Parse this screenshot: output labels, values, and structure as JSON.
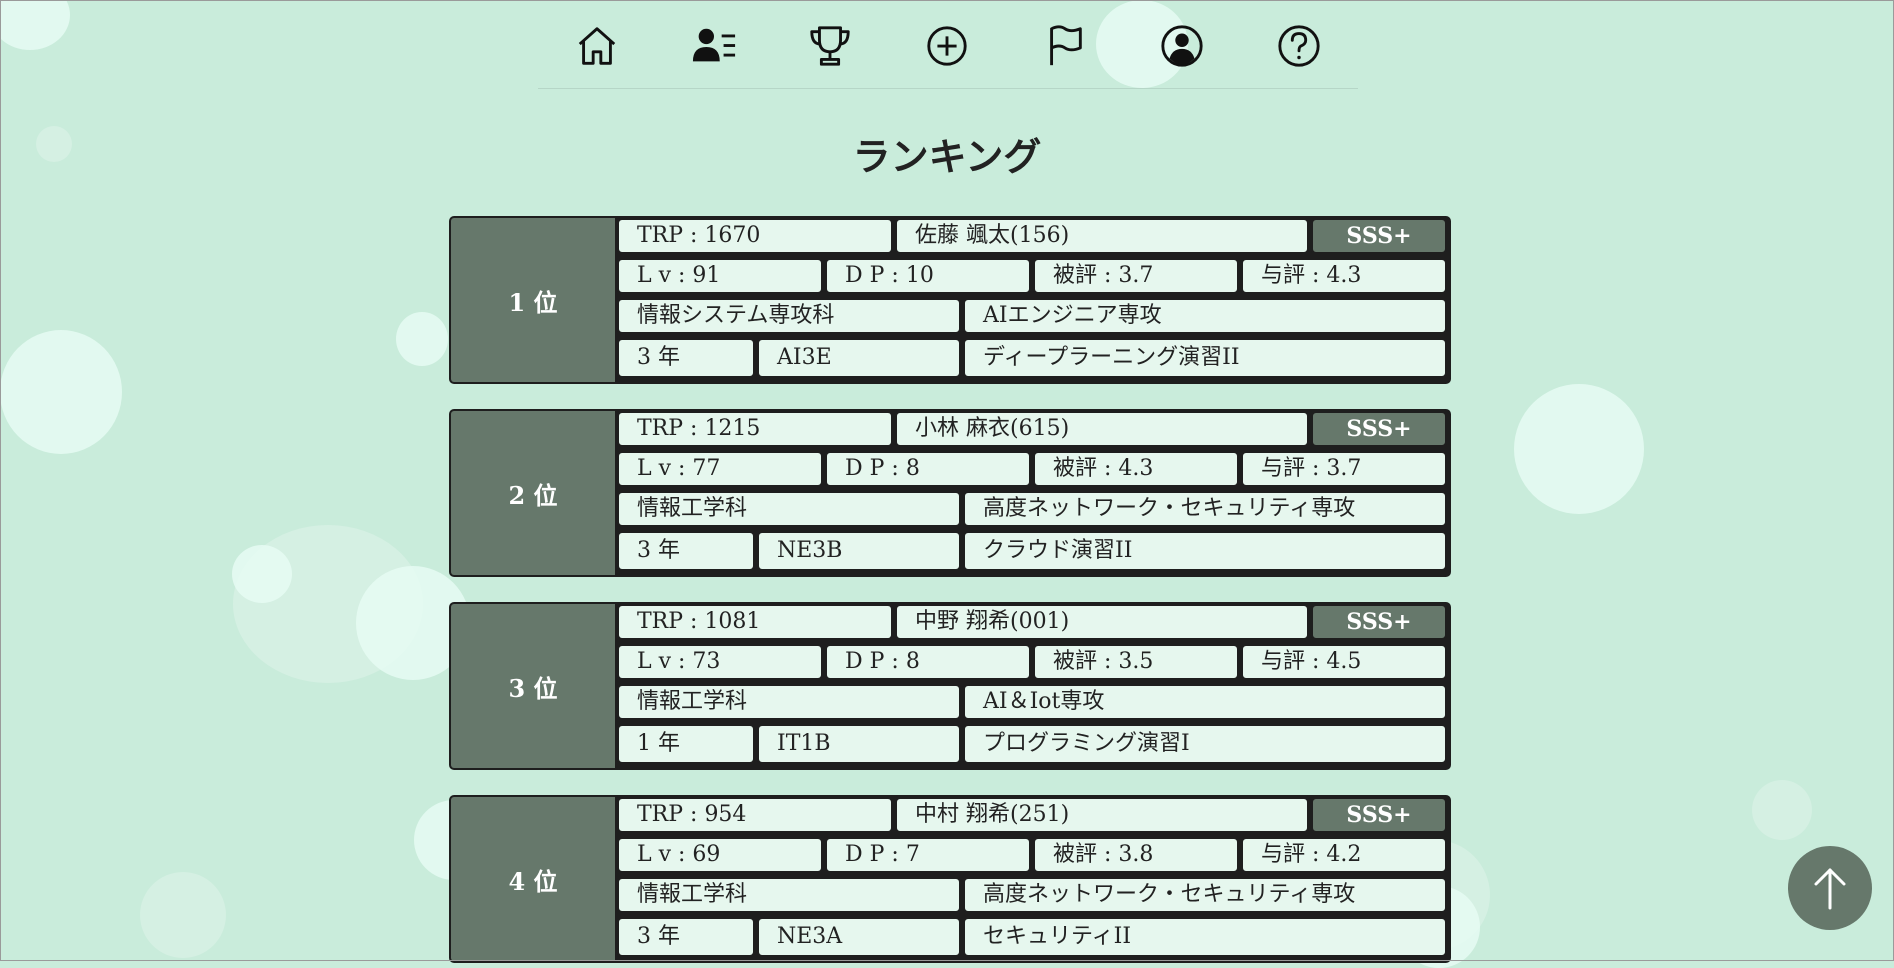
{
  "nav": {
    "items": [
      {
        "icon": "home-icon"
      },
      {
        "icon": "user-list-icon"
      },
      {
        "icon": "trophy-icon"
      },
      {
        "icon": "plus-circle-icon"
      },
      {
        "icon": "flag-icon"
      },
      {
        "icon": "account-circle-icon"
      },
      {
        "icon": "help-circle-icon"
      }
    ]
  },
  "page": {
    "title": "ランキング"
  },
  "rankings": [
    {
      "rank": "1 位",
      "trp": "TRP : 1670",
      "name": "佐藤 颯太(156)",
      "badge": "SSS+",
      "lv": "L v : 91",
      "dp": "D P : 10",
      "hi": "被評 : 3.7",
      "yo": "与評 : 4.3",
      "dept": "情報システム専攻科",
      "major": "AIエンジニア専攻",
      "year": "3 年",
      "class": "AI3E",
      "subject": "ディープラーニング演習II"
    },
    {
      "rank": "2 位",
      "trp": "TRP : 1215",
      "name": "小林 麻衣(615)",
      "badge": "SSS+",
      "lv": "L v : 77",
      "dp": "D P : 8",
      "hi": "被評 : 4.3",
      "yo": "与評 : 3.7",
      "dept": "情報工学科",
      "major": "高度ネットワーク・セキュリティ専攻",
      "year": "3 年",
      "class": "NE3B",
      "subject": "クラウド演習II"
    },
    {
      "rank": "3 位",
      "trp": "TRP : 1081",
      "name": "中野 翔希(001)",
      "badge": "SSS+",
      "lv": "L v : 73",
      "dp": "D P : 8",
      "hi": "被評 : 3.5",
      "yo": "与評 : 4.5",
      "dept": "情報工学科",
      "major": "AI＆Iot専攻",
      "year": "1 年",
      "class": "IT1B",
      "subject": "プログラミング演習I"
    },
    {
      "rank": "4 位",
      "trp": "TRP : 954",
      "name": "中村 翔希(251)",
      "badge": "SSS+",
      "lv": "L v : 69",
      "dp": "D P : 7",
      "hi": "被評 : 3.8",
      "yo": "与評 : 4.2",
      "dept": "情報工学科",
      "major": "高度ネットワーク・セキュリティ専攻",
      "year": "3 年",
      "class": "NE3A",
      "subject": "セキュリティII"
    }
  ],
  "scroll_top": {
    "icon": "arrow-up-icon"
  },
  "colors": {
    "background": "#c9ecdb",
    "rank_panel": "#66786b",
    "cell": "#e6f7ee",
    "border": "#1e1e1e"
  }
}
